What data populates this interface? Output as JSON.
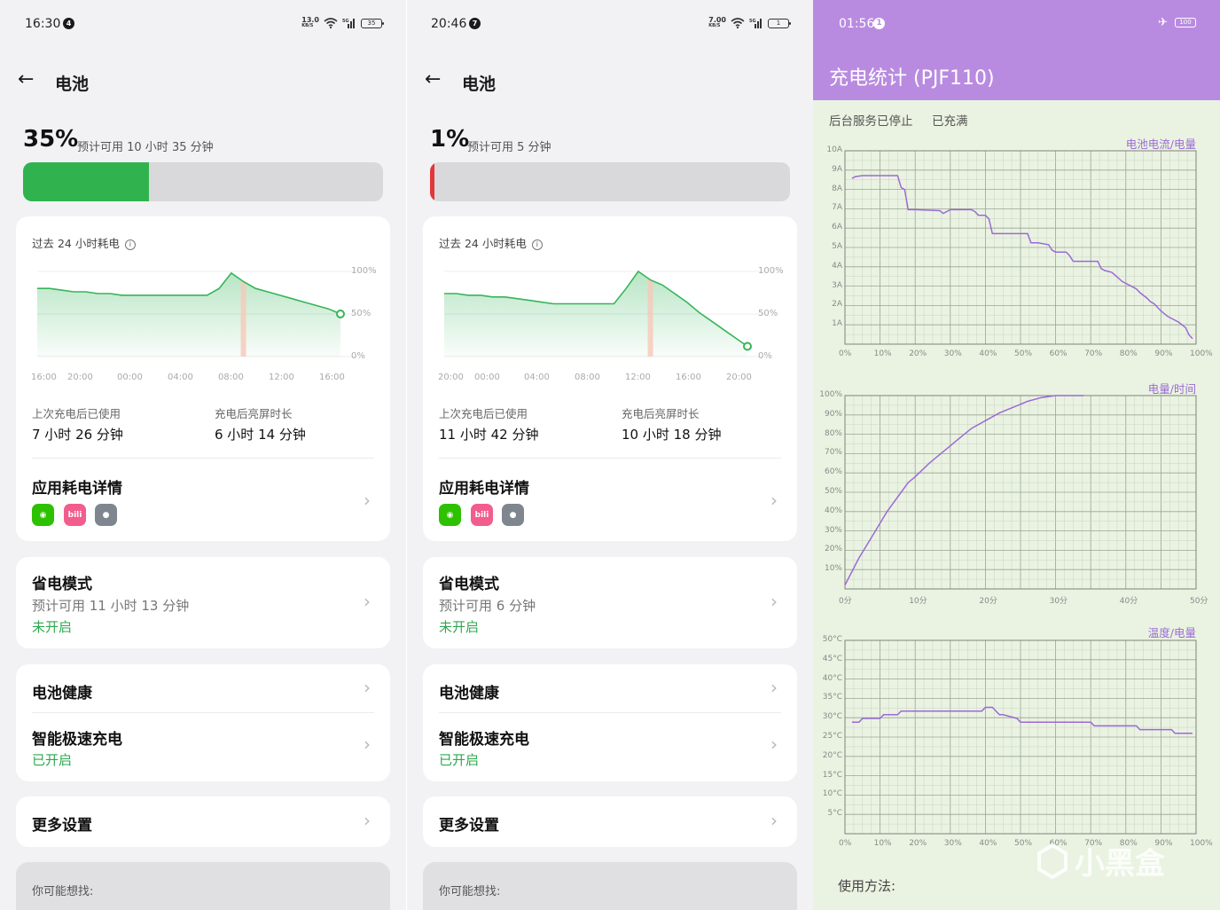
{
  "colors": {
    "accent_green": "#2fa84f",
    "battery_fill_1": "#30b34f",
    "battery_fill_2": "#e0383a",
    "p3_header": "#b98be0",
    "p3_line": "#9b6ad6"
  },
  "phone1": {
    "status": {
      "time": "16:30",
      "notif": "4",
      "net_top": "13.0",
      "net_bot": "KB/S",
      "sig": "5G",
      "battery": "35"
    },
    "header": {
      "title": "电池"
    },
    "battery": {
      "percent_text": "35%",
      "estimate": "预计可用 10 小时 35 分钟",
      "level": 0.35
    },
    "usage_card": {
      "title": "过去 24 小时耗电",
      "y_labels": [
        "100%",
        "50%",
        "0%"
      ],
      "x_labels": [
        "16:00",
        "20:00",
        "00:00",
        "04:00",
        "08:00",
        "12:00",
        "16:00"
      ],
      "since_label": "上次充电后已使用",
      "since_value": "7 小时 26 分钟",
      "screen_label": "充电后亮屏时长",
      "screen_value": "6 小时 14 分钟",
      "apps_title": "应用耗电详情"
    },
    "power_save": {
      "title": "省电模式",
      "estimate": "预计可用 11 小时 13 分钟",
      "state": "未开启"
    },
    "health": {
      "title": "电池健康"
    },
    "fast_charge": {
      "title": "智能极速充电",
      "state": "已开启"
    },
    "more": {
      "title": "更多设置"
    },
    "hint": {
      "text": "你可能想找:"
    }
  },
  "phone2": {
    "status": {
      "time": "20:46",
      "notif": "7",
      "net_top": "7.00",
      "net_bot": "KB/S",
      "sig": "5G",
      "battery": "1"
    },
    "header": {
      "title": "电池"
    },
    "battery": {
      "percent_text": "1%",
      "estimate": "预计可用 5 分钟",
      "level": 0.01
    },
    "usage_card": {
      "title": "过去 24 小时耗电",
      "y_labels": [
        "100%",
        "50%",
        "0%"
      ],
      "x_labels": [
        "20:00",
        "00:00",
        "04:00",
        "08:00",
        "12:00",
        "16:00",
        "20:00"
      ],
      "since_label": "上次充电后已使用",
      "since_value": "11 小时 42 分钟",
      "screen_label": "充电后亮屏时长",
      "screen_value": "10 小时 18 分钟",
      "apps_title": "应用耗电详情"
    },
    "power_save": {
      "title": "省电模式",
      "estimate": "预计可用 6 分钟",
      "state": "未开启"
    },
    "health": {
      "title": "电池健康"
    },
    "fast_charge": {
      "title": "智能极速充电",
      "state": "已开启"
    },
    "more": {
      "title": "更多设置"
    },
    "hint": {
      "text": "你可能想找:"
    }
  },
  "stats": {
    "status": {
      "time": "01:56",
      "notif": "1",
      "battery": "100"
    },
    "title": "充电统计 (PJF110)",
    "service_status": "后台服务已停止",
    "charge_status": "已充满",
    "usage_label": "使用方法:",
    "watermark": "小黑盒"
  },
  "chart_data": [
    {
      "type": "area",
      "title": "过去 24 小时耗电",
      "panel": "phone1",
      "x": [
        0,
        1,
        2,
        3,
        4,
        5,
        6,
        7,
        8,
        9,
        10,
        11,
        12,
        13,
        14,
        15,
        16,
        17,
        18,
        19,
        20,
        21,
        22,
        23,
        24,
        25
      ],
      "values": [
        80,
        80,
        78,
        76,
        76,
        74,
        74,
        72,
        72,
        72,
        72,
        72,
        72,
        72,
        72,
        80,
        98,
        88,
        80,
        76,
        72,
        68,
        64,
        60,
        56,
        50
      ],
      "ylim": [
        0,
        100
      ],
      "x_labels": [
        "16:00",
        "20:00",
        "00:00",
        "04:00",
        "08:00",
        "12:00",
        "16:00"
      ]
    },
    {
      "type": "area",
      "title": "过去 24 小时耗电",
      "panel": "phone2",
      "x": [
        0,
        1,
        2,
        3,
        4,
        5,
        6,
        7,
        8,
        9,
        10,
        11,
        12,
        13,
        14,
        15,
        16,
        17,
        18,
        19,
        20,
        21,
        22,
        23,
        24,
        25
      ],
      "values": [
        74,
        74,
        72,
        72,
        70,
        70,
        68,
        66,
        64,
        62,
        62,
        62,
        62,
        62,
        62,
        80,
        100,
        90,
        84,
        74,
        64,
        52,
        42,
        32,
        22,
        12
      ],
      "ylim": [
        0,
        100
      ],
      "x_labels": [
        "20:00",
        "00:00",
        "04:00",
        "08:00",
        "12:00",
        "16:00",
        "20:00"
      ]
    },
    {
      "type": "line",
      "title": "电池电流/电量",
      "xlabel": "",
      "ylabel": "",
      "x_ticks": [
        "0%",
        "10%",
        "20%",
        "30%",
        "40%",
        "50%",
        "60%",
        "70%",
        "80%",
        "90%",
        "100%"
      ],
      "y_ticks": [
        "10A",
        "9A",
        "8A",
        "7A",
        "6A",
        "5A",
        "4A",
        "3A",
        "2A",
        "1A"
      ],
      "xlim": [
        0,
        100
      ],
      "ylim": [
        0,
        10.5
      ],
      "x": [
        2,
        3,
        5,
        15,
        16,
        17,
        18,
        20,
        27,
        28,
        30,
        36,
        37,
        38,
        40,
        41,
        42,
        52,
        53,
        55,
        58,
        59,
        60,
        63,
        64,
        65,
        72,
        73,
        74,
        76,
        79,
        80,
        82,
        83,
        84,
        86,
        87,
        88,
        90,
        92,
        95,
        97,
        98,
        99
      ],
      "values": [
        9,
        9.1,
        9.15,
        9.15,
        8.5,
        8.4,
        7.3,
        7.3,
        7.25,
        7.1,
        7.3,
        7.3,
        7.2,
        7,
        7,
        6.8,
        6,
        6,
        5.5,
        5.5,
        5.4,
        5.1,
        5,
        5,
        4.8,
        4.5,
        4.5,
        4.1,
        4,
        3.9,
        3.4,
        3.3,
        3.1,
        3,
        2.8,
        2.5,
        2.3,
        2.2,
        1.8,
        1.5,
        1.2,
        0.9,
        0.5,
        0.3
      ]
    },
    {
      "type": "line",
      "title": "电量/时间",
      "x_ticks": [
        "0分",
        "10分",
        "20分",
        "30分",
        "40分",
        "50分"
      ],
      "y_ticks": [
        "100%",
        "90%",
        "80%",
        "70%",
        "60%",
        "50%",
        "40%",
        "30%",
        "20%",
        "10%"
      ],
      "xlim": [
        0,
        50
      ],
      "ylim": [
        0,
        100
      ],
      "x": [
        0,
        1,
        2,
        3,
        4,
        5,
        6,
        7,
        8,
        9,
        10,
        12,
        14,
        16,
        18,
        20,
        22,
        24,
        26,
        28,
        30,
        32,
        34
      ],
      "values": [
        2,
        9,
        16,
        22,
        28,
        34,
        40,
        45,
        50,
        55,
        58,
        65,
        71,
        77,
        83,
        87,
        91,
        94,
        97,
        99,
        100,
        100,
        100
      ]
    },
    {
      "type": "line",
      "title": "温度/电量",
      "x_ticks": [
        "0%",
        "10%",
        "20%",
        "30%",
        "40%",
        "50%",
        "60%",
        "70%",
        "80%",
        "90%",
        "100%"
      ],
      "y_ticks": [
        "50°C",
        "45°C",
        "40°C",
        "35°C",
        "30°C",
        "25°C",
        "20°C",
        "15°C",
        "10°C",
        "5°C"
      ],
      "xlim": [
        0,
        100
      ],
      "ylim": [
        0,
        52
      ],
      "x": [
        2,
        4,
        5,
        10,
        11,
        15,
        16,
        39,
        40,
        42,
        44,
        45,
        49,
        50,
        70,
        71,
        83,
        84,
        93,
        94,
        99
      ],
      "values": [
        30,
        30,
        31,
        31,
        32,
        32,
        33,
        33,
        34,
        34,
        32,
        32,
        31,
        30,
        30,
        29,
        29,
        28,
        28,
        27,
        27
      ]
    }
  ]
}
